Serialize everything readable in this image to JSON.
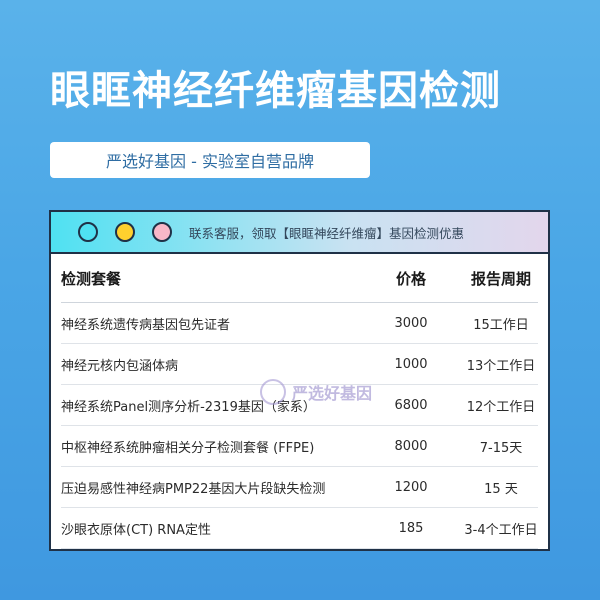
{
  "header": {
    "title": "眼眶神经纤维瘤基因检测",
    "subtitle": "严选好基因 - 实验室自营品牌"
  },
  "panel": {
    "notice": "联系客服，领取【眼眶神经纤维瘤】基因检测优惠",
    "dots": [
      "#4fe1f2",
      "#ffd02e",
      "#f8b7c8"
    ],
    "columns": [
      "检测套餐",
      "价格",
      "报告周期"
    ],
    "rows": [
      {
        "name": "神经系统遗传病基因包先证者",
        "price": "3000",
        "period": "15工作日"
      },
      {
        "name": "神经元核内包涵体病",
        "price": "1000",
        "period": "13个工作日"
      },
      {
        "name": "神经系统Panel测序分析-2319基因（家系）",
        "price": "6800",
        "period": "12个工作日"
      },
      {
        "name": "中枢神经系统肿瘤相关分子检测套餐 (FFPE)",
        "price": "8000",
        "period": "7-15天"
      },
      {
        "name": "压迫易感性神经病PMP22基因大片段缺失检测",
        "price": "1200",
        "period": "15 天"
      },
      {
        "name": "沙眼衣原体(CT) RNA定性",
        "price": "185",
        "period": "3-4个工作日"
      }
    ]
  },
  "watermark": {
    "text": "严选好基因"
  }
}
